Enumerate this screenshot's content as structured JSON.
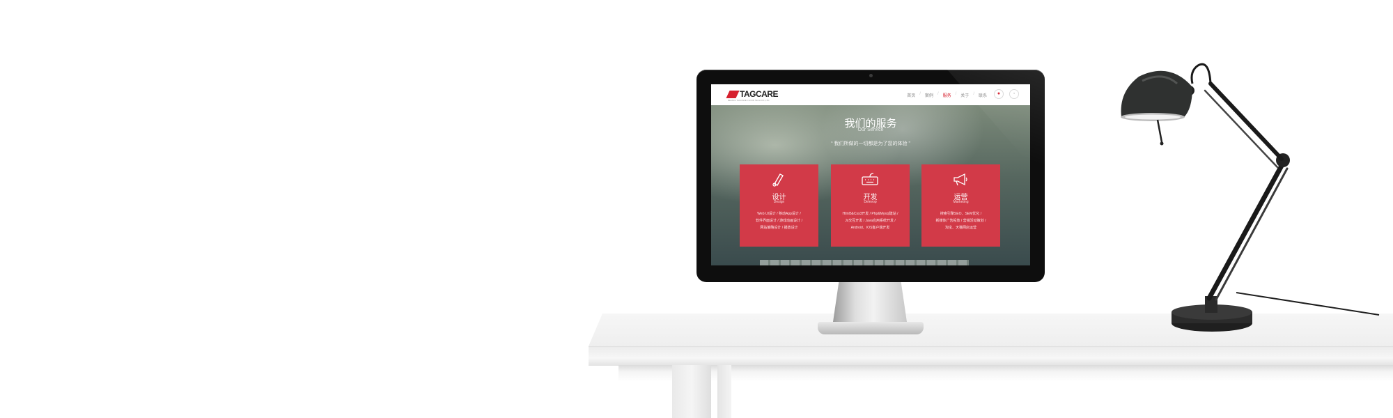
{
  "site": {
    "logo": "TAGCARE",
    "logo_sub": "BEIJING TAGCARE CLOUD TECH CO.,LTD",
    "nav": [
      "首页",
      "案例",
      "服务",
      "关于",
      "联系"
    ],
    "nav_active_index": 2
  },
  "hero": {
    "title": "我们的服务",
    "subtitle": "Our Service",
    "tagline": "“ 我们所做的一切都是为了您的体验 ”"
  },
  "cards": [
    {
      "title": "设计",
      "subtitle": "Design",
      "lines": [
        "Web UI设计  /  移动App设计  /",
        "软件界面设计  /  游戏动画设计  /",
        "网站策略设计  /  播放设计"
      ]
    },
    {
      "title": "开发",
      "subtitle": "Delevop",
      "lines": [
        "Html5&Css3开发  /  Php&Mysql建站  /",
        "Js交互开发  /  Java应用系统开发  /",
        "Android、IOS客户端开发"
      ]
    },
    {
      "title": "运营",
      "subtitle": "Marketing",
      "lines": [
        "搜索引擎SEO、SEM优化  /",
        "新媒体广告投放  /  营销活动策划  /",
        "淘宝、天猫网店运营"
      ]
    }
  ],
  "colors": {
    "brand_red": "#d23a48",
    "monitor_bezel": "#0e0e0e",
    "lamp": "#2a2a2a"
  }
}
